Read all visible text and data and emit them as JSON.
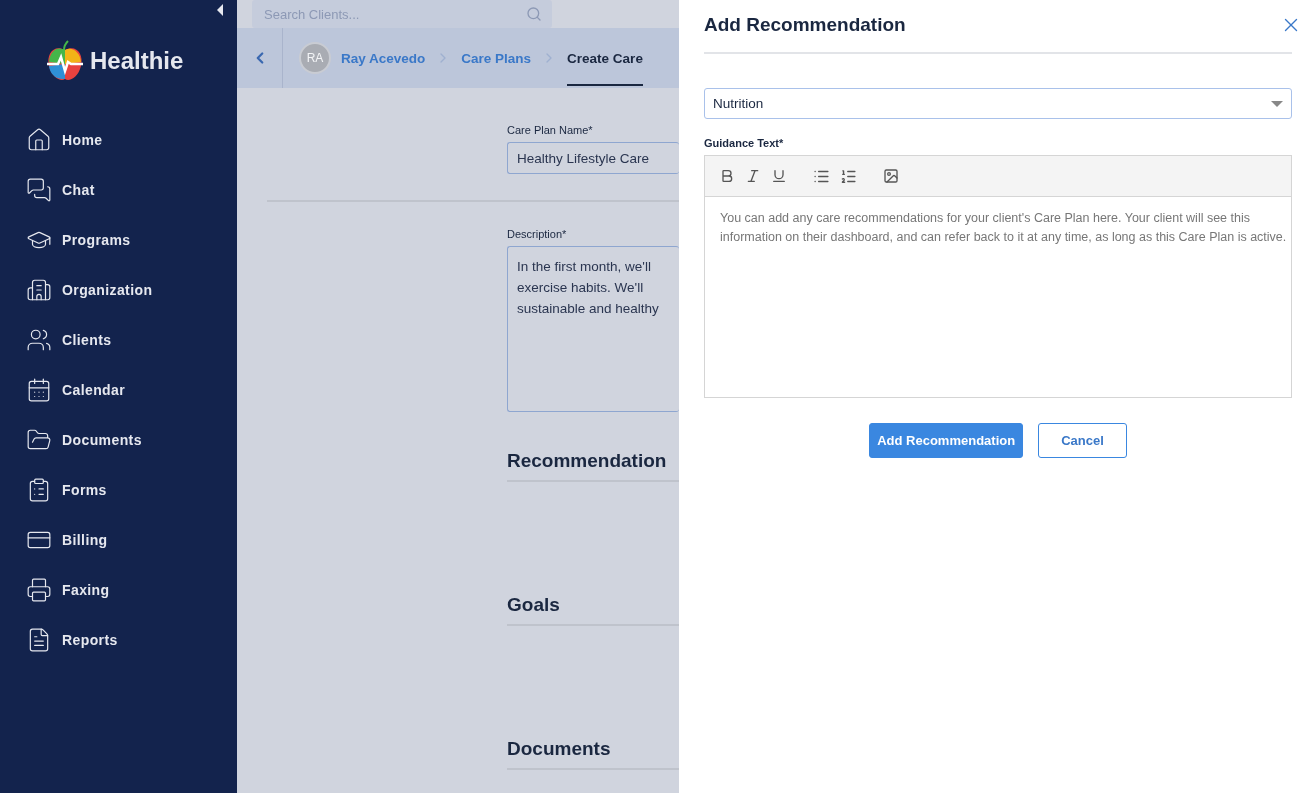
{
  "sidebar": {
    "brand": "Healthie",
    "items": [
      {
        "label": "Home"
      },
      {
        "label": "Chat"
      },
      {
        "label": "Programs"
      },
      {
        "label": "Organization"
      },
      {
        "label": "Clients"
      },
      {
        "label": "Calendar"
      },
      {
        "label": "Documents"
      },
      {
        "label": "Forms"
      },
      {
        "label": "Billing"
      },
      {
        "label": "Faxing"
      },
      {
        "label": "Reports"
      }
    ]
  },
  "search": {
    "placeholder": "Search Clients..."
  },
  "breadcrumbs": {
    "avatar": "RA",
    "items": [
      {
        "label": "Ray Acevedo",
        "selected": false
      },
      {
        "label": "Care Plans",
        "selected": false
      },
      {
        "label": "Create Care",
        "selected": true
      }
    ]
  },
  "form": {
    "name_label": "Care Plan Name*",
    "name_value": "Healthy Lifestyle Care",
    "description_label": "Description*",
    "description_lines": [
      "In the first month, we'll",
      "exercise habits. We'll",
      "sustainable and healthy"
    ],
    "sections": [
      "Recommendation",
      "Goals",
      "Documents"
    ]
  },
  "panel": {
    "title": "Add Recommendation",
    "category": "Nutrition",
    "guidance_label": "Guidance Text*",
    "guidance_placeholder": "You can add any care recommendations for your client's Care Plan here. Your client will see this information on their dashboard, and can refer back to it at any time, as long as this Care Plan is active.",
    "buttons": [
      {
        "label": "Add Recommendation",
        "kind": "primary"
      },
      {
        "label": "Cancel",
        "kind": "secondary"
      }
    ]
  }
}
